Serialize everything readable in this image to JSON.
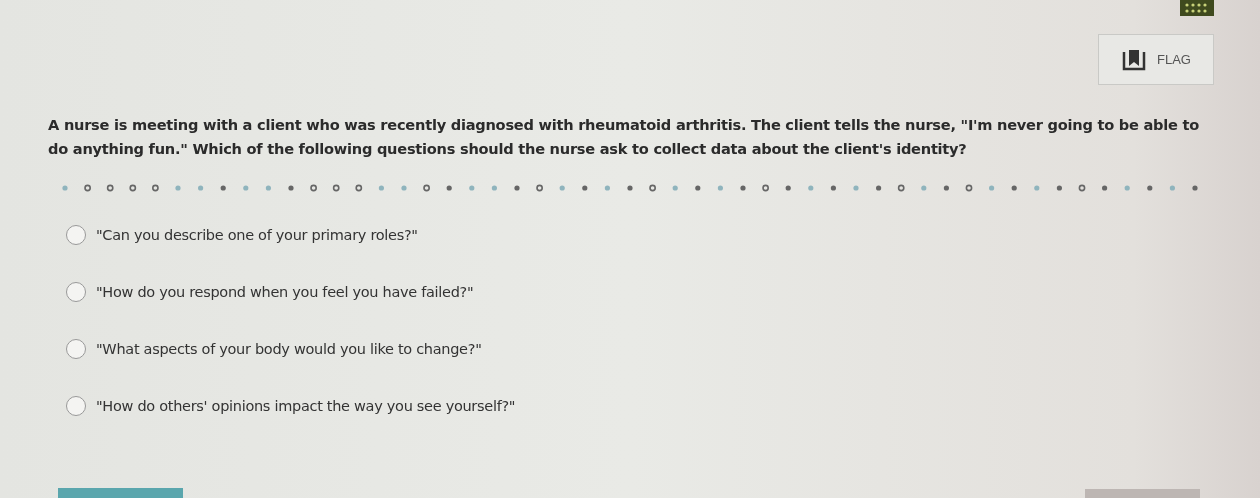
{
  "flag_button": {
    "label": "FLAG"
  },
  "question": "A nurse is meeting with a client who was recently diagnosed with rheumatoid arthritis. The client tells the nurse, \"I'm never going to be able to do anything fun.\" Which of the following questions should the nurse ask to collect data about the client's identity?",
  "options": [
    {
      "label": "\"Can you describe one of your primary roles?\"",
      "selected": false
    },
    {
      "label": "\"How do you respond when you feel you have failed?\"",
      "selected": false
    },
    {
      "label": "\"What aspects of your body would you like to change?\"",
      "selected": false
    },
    {
      "label": "\"How do others' opinions impact the way you see yourself?\"",
      "selected": false
    }
  ]
}
